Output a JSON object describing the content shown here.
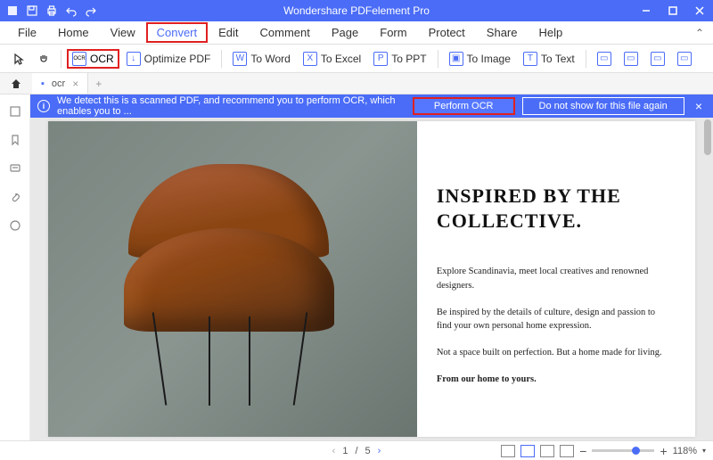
{
  "titlebar": {
    "app_title": "Wondershare PDFelement Pro"
  },
  "menu": {
    "items": [
      "File",
      "Home",
      "View",
      "Convert",
      "Edit",
      "Comment",
      "Page",
      "Form",
      "Protect",
      "Share",
      "Help"
    ],
    "highlighted_index": 3
  },
  "toolbar": {
    "ocr": "OCR",
    "optimize": "Optimize PDF",
    "to_word": "To Word",
    "to_excel": "To Excel",
    "to_ppt": "To PPT",
    "to_image": "To Image",
    "to_text": "To Text"
  },
  "tabs": {
    "items": [
      {
        "label": "ocr"
      }
    ]
  },
  "banner": {
    "message": "We detect this is a scanned PDF, and recommend you to perform OCR, which enables you to ...",
    "perform": "Perform OCR",
    "dismiss": "Do not show for this file again"
  },
  "document": {
    "heading": "INSPIRED BY THE COLLECTIVE.",
    "p1": "Explore Scandinavia, meet local creatives and renowned designers.",
    "p2": "Be inspired by the details of culture, design and passion to find your own personal home expression.",
    "p3": "Not a space built on perfection. But a home made for living.",
    "p4": "From our home to yours."
  },
  "status": {
    "page_current": "1",
    "page_sep": "/",
    "page_total": "5",
    "zoom_minus": "−",
    "zoom_plus": "+",
    "zoom_pct": "118%"
  }
}
